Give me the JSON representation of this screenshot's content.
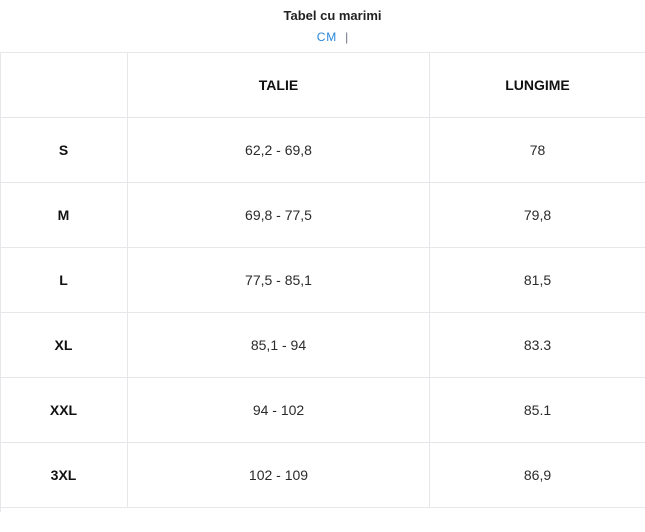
{
  "header": {
    "title": "Tabel cu marimi",
    "unit_label": "CM",
    "unit_separator": "|"
  },
  "table": {
    "columns": [
      "",
      "TALIE",
      "LUNGIME"
    ],
    "rows": [
      {
        "size": "S",
        "talie": "62,2 - 69,8",
        "lungime": "78"
      },
      {
        "size": "M",
        "talie": "69,8 - 77,5",
        "lungime": "79,8"
      },
      {
        "size": "L",
        "talie": "77,5 - 85,1",
        "lungime": "81,5"
      },
      {
        "size": "XL",
        "talie": "85,1 - 94",
        "lungime": "83.3"
      },
      {
        "size": "XXL",
        "talie": "94 - 102",
        "lungime": "85.1"
      },
      {
        "size": "3XL",
        "talie": "102 - 109",
        "lungime": "86,9"
      }
    ]
  },
  "colors": {
    "accent": "#2a86d9",
    "border": "#e5e7eb",
    "text": "#1f1f1f"
  }
}
